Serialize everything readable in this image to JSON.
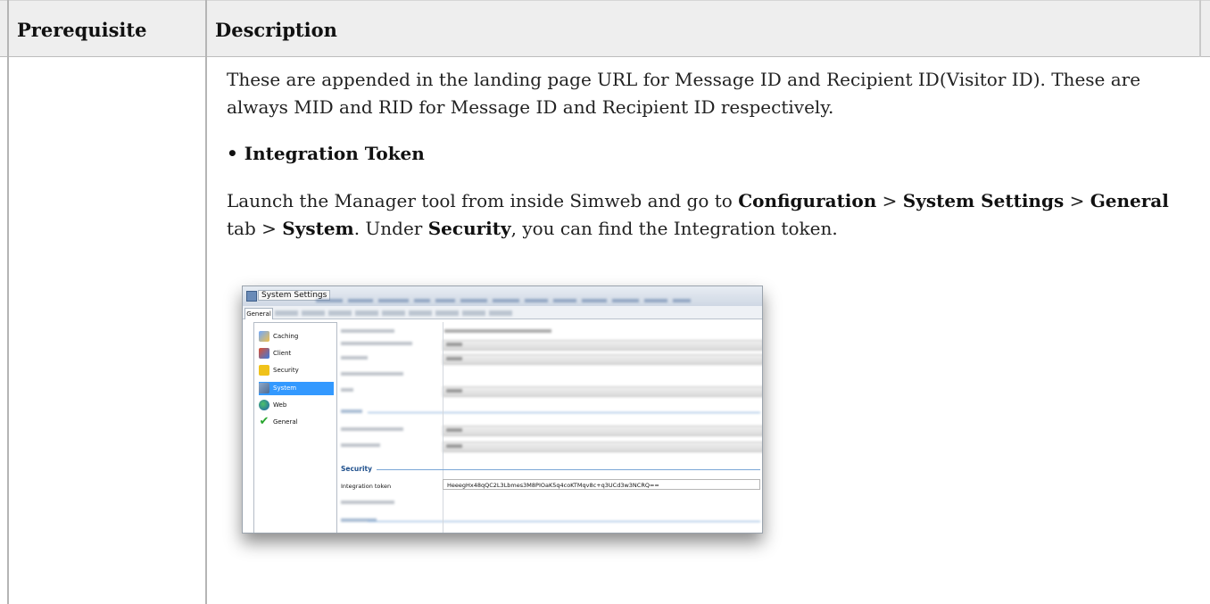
{
  "table": {
    "headers": [
      "Prerequisite",
      "Description"
    ],
    "paragraph1": "These are appended in the landing page URL for Message ID and Recipient ID(Visitor ID). These are always MID and RID for Message ID and Recipient ID respectively.",
    "bullet": "• Integration Token",
    "p2": {
      "t1": "Launch the Manager tool from inside Simweb and go to ",
      "b1": "Configuration",
      "t2": " > ",
      "b2": "System Settings",
      "t3": " > ",
      "b3": "General",
      "t4": " tab > ",
      "b4": "System",
      "t5": ". Under ",
      "b5": "Security",
      "t6": ", you can find the Integration token."
    }
  },
  "screenshot": {
    "window_title": "System Settings",
    "active_tab": "General",
    "tree": [
      {
        "label": "Caching",
        "icon": "caching-icon"
      },
      {
        "label": "Client",
        "icon": "client-icon"
      },
      {
        "label": "Security",
        "icon": "lock-icon"
      },
      {
        "label": "System",
        "icon": "wrench-icon",
        "selected": true
      },
      {
        "label": "Web",
        "icon": "globe-icon"
      },
      {
        "label": "General",
        "icon": "checkmark-icon"
      }
    ],
    "security_section": "Security",
    "integration_token_label": "Integration token",
    "integration_token_value": "HeeegHx48qQC2L3Lbmes3M8PIOaK5q4coKTMqv8c+q3UCd3w3NCRQ=="
  },
  "colors": {
    "header_bg": "#eeeeee",
    "selection": "#3399ff",
    "section_title": "#1e4f8c"
  }
}
